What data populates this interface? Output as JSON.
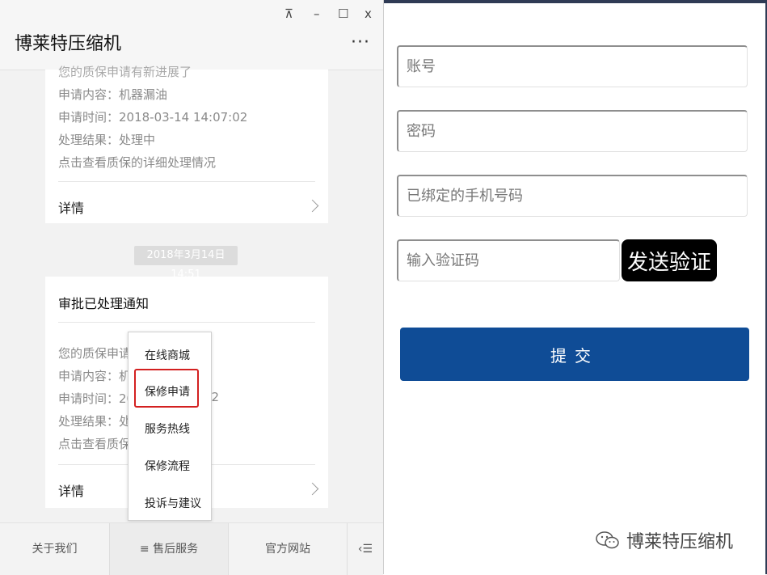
{
  "window": {
    "title": "博莱特压缩机",
    "controls": {
      "pin": "⊼",
      "minimize": "–",
      "maximize": "☐",
      "close": "x"
    },
    "more": "···"
  },
  "card1": {
    "partial_line": "您的质保申请有新进展了",
    "lines": [
      "申请内容：机器漏油",
      "申请时间：2018-03-14 14:07:02",
      "处理结果：处理中",
      "点击查看质保的详细处理情况"
    ],
    "detail_label": "详情"
  },
  "timestamp": "2018年3月14日 14:51",
  "card2": {
    "title": "审批已处理通知",
    "lines": [
      "您的质保申请有",
      "申请内容：机器",
      "申请时间：2018",
      "处理结果：处理",
      "点击查看质保的"
    ],
    "time_tail": "02",
    "detail_label": "详情"
  },
  "popup_menu": {
    "items": [
      "在线商城",
      "保修申请",
      "服务热线",
      "保修流程",
      "投诉与建议"
    ],
    "highlighted_index": 1
  },
  "bottom_nav": {
    "items": [
      "关于我们",
      "≡ 售后服务",
      "官方网站"
    ],
    "keyboard_icon": "‹☰"
  },
  "form": {
    "account_placeholder": "账号",
    "password_placeholder": "密码",
    "phone_placeholder": "已绑定的手机号码",
    "code_placeholder": "输入验证码",
    "send_code_label": "发送验证",
    "submit_label": "提交"
  },
  "watermark": {
    "text": "博莱特压缩机",
    "icon": "wechat-icon"
  },
  "colors": {
    "submit": "#0f4c96",
    "highlight": "#d32020",
    "send_button": "#000000"
  }
}
